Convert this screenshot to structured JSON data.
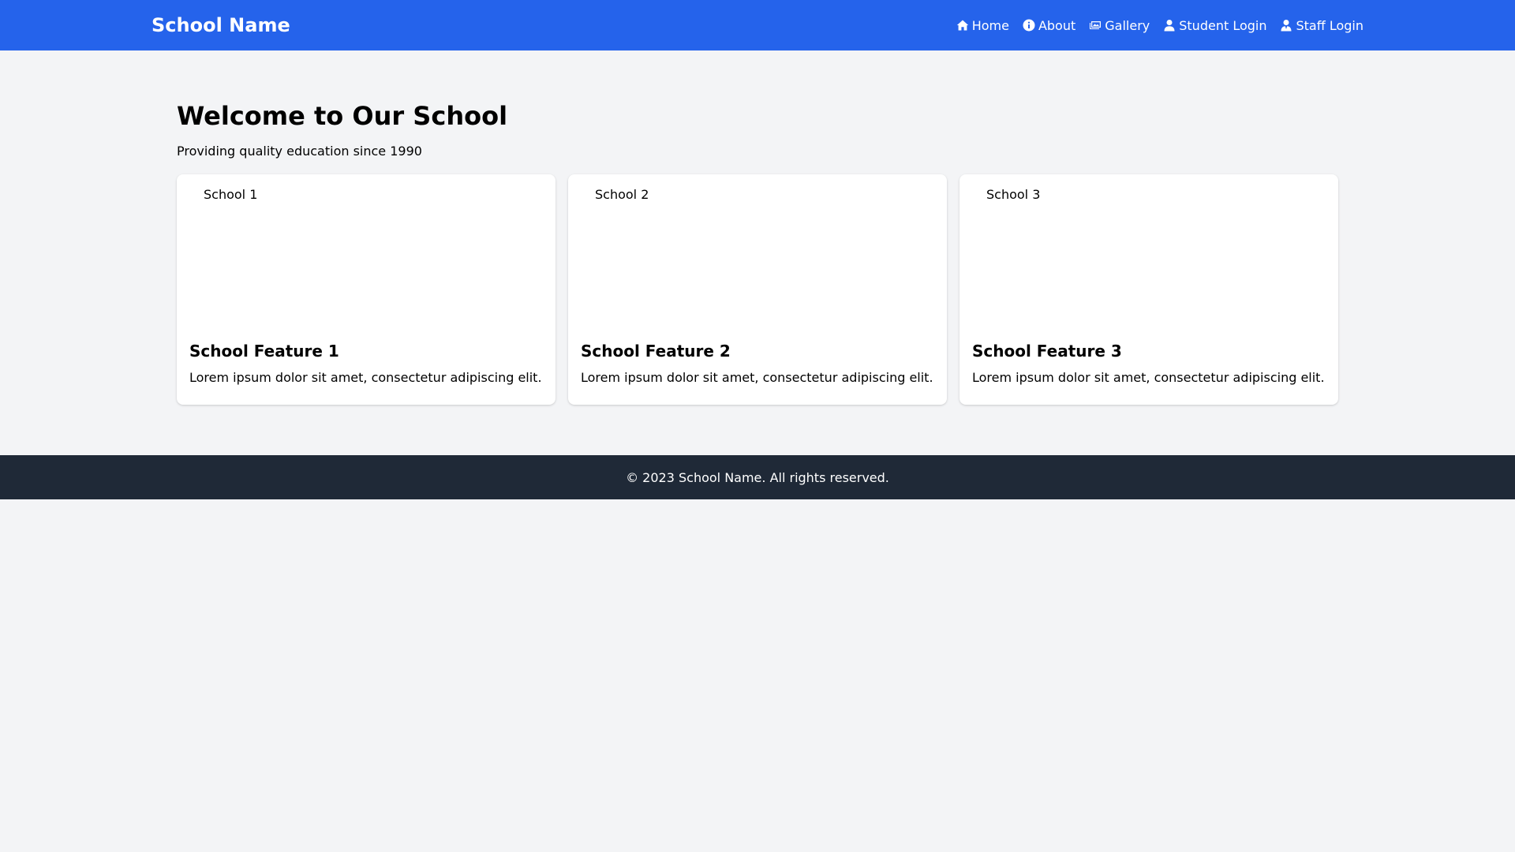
{
  "header": {
    "brand": "School Name",
    "nav": [
      {
        "label": "Home",
        "icon": "home-icon"
      },
      {
        "label": "About",
        "icon": "info-icon"
      },
      {
        "label": "Gallery",
        "icon": "images-icon"
      },
      {
        "label": "Student Login",
        "icon": "user-icon"
      },
      {
        "label": "Staff Login",
        "icon": "user-tie-icon"
      }
    ]
  },
  "hero": {
    "title": "Welcome to Our School",
    "subtitle": "Providing quality education since 1990"
  },
  "cards": [
    {
      "image_alt": "School 1",
      "title": "School Feature 1",
      "text": "Lorem ipsum dolor sit amet, consectetur adipiscing elit."
    },
    {
      "image_alt": "School 2",
      "title": "School Feature 2",
      "text": "Lorem ipsum dolor sit amet, consectetur adipiscing elit."
    },
    {
      "image_alt": "School 3",
      "title": "School Feature 3",
      "text": "Lorem ipsum dolor sit amet, consectetur adipiscing elit."
    }
  ],
  "footer": {
    "text": "© 2023 School Name. All rights reserved."
  },
  "colors": {
    "navbar": "#2563eb",
    "background": "#f3f4f6",
    "footer": "#1f2937"
  }
}
